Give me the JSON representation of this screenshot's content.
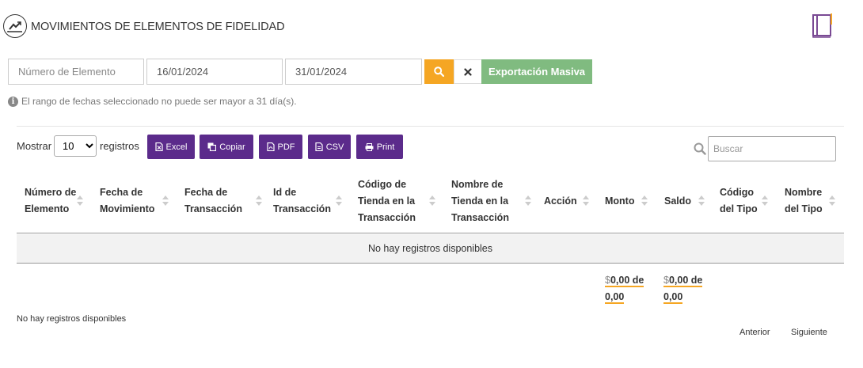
{
  "header": {
    "title": "MOVIMIENTOS DE ELEMENTOS DE FIDELIDAD",
    "title_icon": "trend-chart-icon",
    "book_icon": "book-icon"
  },
  "filters": {
    "element_placeholder": "Número de Elemento",
    "date_from": "16/01/2024",
    "date_to": "31/01/2024",
    "search_icon": "search-icon",
    "clear_icon": "close-icon",
    "export_label": "Exportación Masiva",
    "info_text": "El rango de fechas seleccionado no puede ser mayor a 31 día(s)."
  },
  "table_controls": {
    "show_label": "Mostrar",
    "page_size": "10",
    "records_label": "registros",
    "buttons": {
      "excel": "Excel",
      "copy": "Copiar",
      "pdf": "PDF",
      "csv": "CSV",
      "print": "Print"
    },
    "search_placeholder": "Buscar"
  },
  "table": {
    "columns": [
      "Número de Elemento",
      "Fecha de Movimiento",
      "Fecha de Transacción",
      "Id de Transacción",
      "Código de Tienda en la Transacción",
      "Nombre de Tienda en la Transacción",
      "Acción",
      "Monto",
      "Saldo",
      "Código del Tipo",
      "Nombre del Tipo"
    ],
    "empty_message": "No hay registros disponibles",
    "footer": {
      "monto_currency": "$",
      "monto_text": "0,00 de",
      "monto_total": "0,00",
      "saldo_currency": "$",
      "saldo_text": "0,00 de",
      "saldo_total": "0,00"
    }
  },
  "pagination": {
    "info": "No hay registros disponibles",
    "previous": "Anterior",
    "next": "Siguiente"
  },
  "colors": {
    "accent_orange": "#f5a623",
    "export_green": "#80bb80",
    "button_purple": "#5b2b8b"
  }
}
